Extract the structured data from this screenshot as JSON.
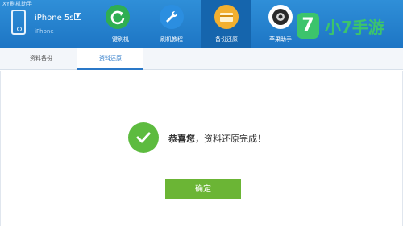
{
  "window": {
    "title": "XY刷机助手"
  },
  "device": {
    "name": "iPhone 5s",
    "dropdown_icon": "▼",
    "subtitle": "iPhone"
  },
  "nav": {
    "items": [
      {
        "label": "一键刷机",
        "icon": "refresh-icon",
        "color": "#2fae52"
      },
      {
        "label": "刷机教程",
        "icon": "wrench-icon",
        "color": "#2b8ee0"
      },
      {
        "label": "备份还原",
        "icon": "folder-icon",
        "color": "#f2b02f",
        "active": true
      },
      {
        "label": "苹果助手",
        "icon": "camera-icon",
        "color": "#2a2a2a"
      }
    ]
  },
  "watermark": {
    "badge": "7",
    "text": "小7手游"
  },
  "tabs": [
    {
      "label": "资料备份"
    },
    {
      "label": "资料还原",
      "active": true
    }
  ],
  "message": {
    "strong": "恭喜您",
    "text": "，资料还原完成！"
  },
  "ok_button": {
    "label": "确定"
  },
  "colors": {
    "topbar": "#1d75c4",
    "success": "#5dbb3f",
    "button": "#6bb535"
  }
}
